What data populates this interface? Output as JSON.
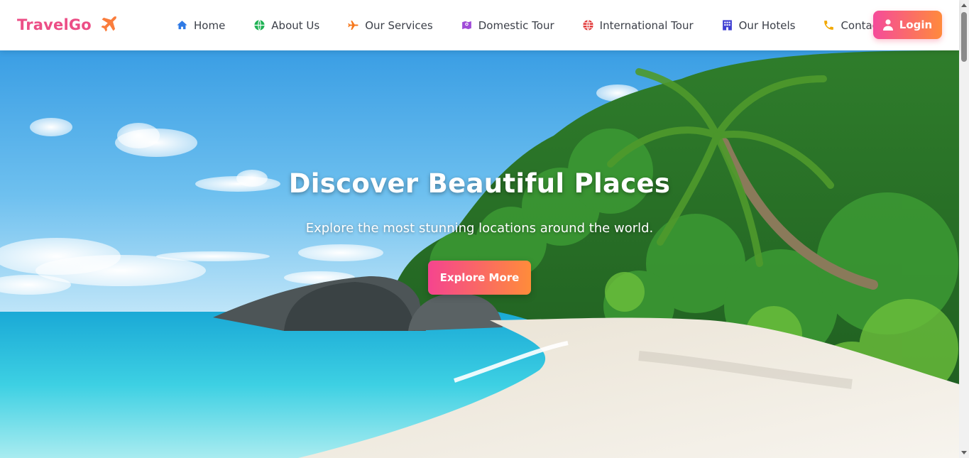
{
  "brand": {
    "name": "TravelGo",
    "icon": "plane-icon",
    "color": "#ec4e86",
    "icon_color": "#fa7d3c"
  },
  "nav": {
    "items": [
      {
        "label": "Home",
        "icon": "home-icon",
        "icon_color": "#2f7ae5"
      },
      {
        "label": "About Us",
        "icon": "globe-icon",
        "icon_color": "#1fb254"
      },
      {
        "label": "Our Services",
        "icon": "plane-icon",
        "icon_color": "#f6781d"
      },
      {
        "label": "Domestic Tour",
        "icon": "map-marker-icon",
        "icon_color": "#a04bd8"
      },
      {
        "label": "International Tour",
        "icon": "globe-icon",
        "icon_color": "#e02f2f"
      },
      {
        "label": "Our Hotels",
        "icon": "hotel-icon",
        "icon_color": "#3f3fd2"
      },
      {
        "label": "Contact",
        "icon": "phone-icon",
        "icon_color": "#f2a800"
      }
    ],
    "login": {
      "label": "Login",
      "icon": "user-icon"
    }
  },
  "hero": {
    "title": "Discover Beautiful Places",
    "subtitle": "Explore the most stunning locations around the world.",
    "cta_label": "Explore More"
  },
  "colors": {
    "accent_start": "#f54b9a",
    "accent_end": "#ff8a3c"
  }
}
